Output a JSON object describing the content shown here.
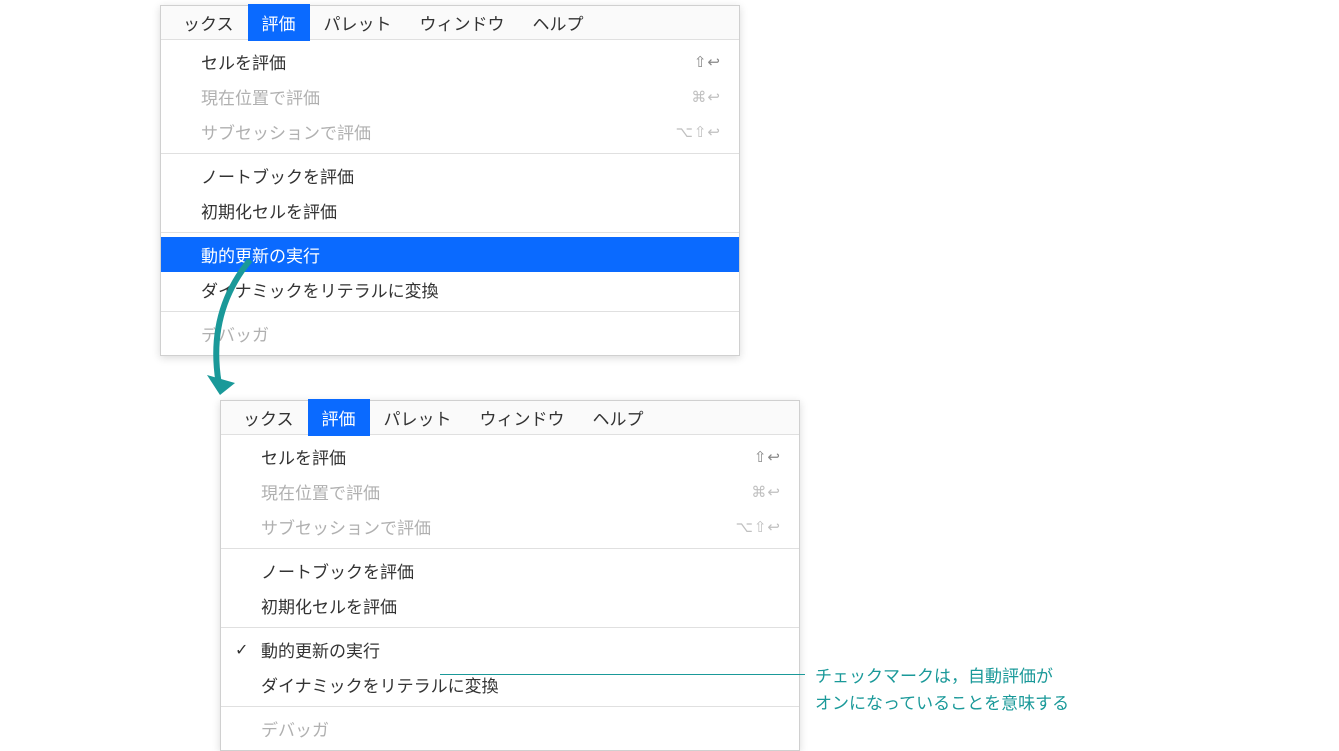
{
  "menubar": {
    "items": [
      {
        "label": "ックス"
      },
      {
        "label": "評価"
      },
      {
        "label": "パレット"
      },
      {
        "label": "ウィンドウ"
      },
      {
        "label": "ヘルプ"
      }
    ]
  },
  "menu": {
    "group1": [
      {
        "label": "セルを評価",
        "shortcut": "⇧↩"
      },
      {
        "label": "現在位置で評価",
        "shortcut": "⌘↩"
      },
      {
        "label": "サブセッションで評価",
        "shortcut": "⌥⇧↩"
      }
    ],
    "group2": [
      {
        "label": "ノートブックを評価"
      },
      {
        "label": "初期化セルを評価"
      }
    ],
    "group3": [
      {
        "label": "動的更新の実行"
      },
      {
        "label": "ダイナミックをリテラルに変換"
      }
    ],
    "group4": [
      {
        "label": "デバッガ"
      }
    ]
  },
  "annotation": {
    "line1": "チェックマークは，自動評価が",
    "line2": "オンになっていることを意味する"
  },
  "checkmark": "✓"
}
